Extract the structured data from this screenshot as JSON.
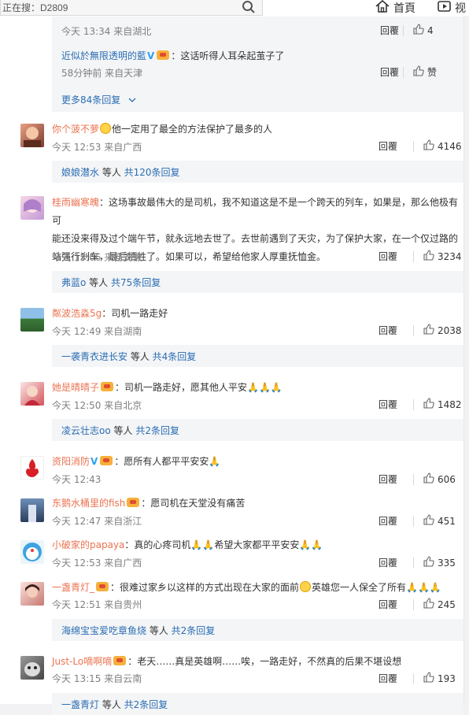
{
  "search": {
    "value": "正在搜：D2809"
  },
  "nav": {
    "home": "首頁",
    "video": "视"
  },
  "top_sub": {
    "first_meta": "今天 13:34 来自湖北",
    "first_like": "4",
    "reply_user": "近似於無限透明的藍",
    "reply_text": "：这话听得人耳朵起茧子了",
    "reply_meta": "58分钟前 来自天津",
    "reply_like": "赞",
    "more": "更多84条回复"
  },
  "reply_label": "回覆",
  "comments": [
    {
      "user": "你个菠不萝",
      "text": "他一定用了最全的方法保护了最多的人",
      "meta": "今天 12:53 来自广西",
      "likes": "4146",
      "sub": {
        "user": "娘娘潜水",
        "mid": " 等人 ",
        "count": "共120条回复"
      }
    },
    {
      "user": "桂雨幽寒魄",
      "lines": [
        "：这场事故最伟大的是司机，我不知道这是不是一个跨天的列车，如果是，那么他极有可",
        "能还没来得及过个端午节，就永远地去世了。去世前遇到了天灾，为了保护大家，在一个仅过路的",
        "站强行刹车，最后牺牲了。如果可以，希望给他家人厚重抚恤金。"
      ],
      "meta": "今天 13:06 来自安徽",
      "likes": "3234",
      "sub": {
        "user": "弗蓝o",
        "mid": " 等人 ",
        "count": "共75条回复"
      }
    },
    {
      "user": "粼波浩淼5g",
      "text": "：司机一路走好",
      "meta": "今天 12:49 来自湖南",
      "likes": "2038",
      "sub": {
        "user": "一袭青衣进长安",
        "mid": " 等人 ",
        "count": "共4条回复"
      }
    },
    {
      "user": "她是晴晴子",
      "text": "：司机一路走好，愿其他人平安",
      "meta": "今天 12:50 来自北京",
      "likes": "1482",
      "sub": {
        "user": "凌云壮志oo",
        "mid": " 等人 ",
        "count": "共2条回复"
      }
    },
    {
      "user": "资阳消防",
      "text": "：愿所有人都平平安安",
      "meta": "今天 12:43",
      "likes": "606"
    },
    {
      "user": "东鹅水桶里的fish",
      "text": "：愿司机在天堂没有痛苦",
      "meta": "今天 12:47 来自浙江",
      "likes": "451"
    },
    {
      "user": "小破家的papaya",
      "text": "：真的心疼司机",
      "text2": "希望大家都平平安安",
      "meta": "今天 12:53 来自广西",
      "likes": "335"
    },
    {
      "user": "一盏青灯_",
      "text": "：很难过家乡以这样的方式出现在大家的面前",
      "text2": "英雄您一人保全了所有",
      "meta": "今天 12:51 来自贵州",
      "likes": "245",
      "sub": {
        "user": "海绵宝宝爱吃章鱼烧",
        "mid": " 等人 ",
        "count": "共2条回复"
      }
    },
    {
      "user": "Just-Lo嘀啊嘀",
      "text": "：老天……真是英雄啊……唉，一路走好，不然真的后果不堪设想",
      "meta": "今天 13:15 来自云南",
      "likes": "193",
      "sub": {
        "user": "一盏青灯",
        "mid": " 等人 ",
        "count": "共2条回复"
      }
    }
  ]
}
